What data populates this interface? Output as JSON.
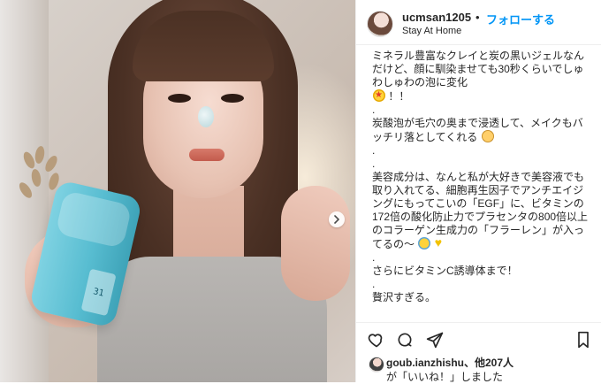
{
  "header": {
    "username": "ucmsan1205",
    "separator": "•",
    "follow_label": "フォローする",
    "location": "Stay At Home"
  },
  "post": {
    "caption_paragraphs": [
      "ミネラル豊富なクレイと炭の黒いジェルなんだけど、顔に馴染ませても30秒くらいでしゅわしゅわの泡に変化",
      "！！",
      ".",
      "炭酸泡が毛穴の奥まで浸透して、メイクもバッチリ落としてくれる",
      ".",
      ".",
      "美容成分は、なんと私が大好きで美容液でも取り入れてる、細胞再生因子でアンチエイジングにもってこいの「EGF」に、ビタミンの172倍の酸化防止力でプラセンタの800倍以上のコラーゲン生成力の「フラーレン」が入ってるの〜",
      ".",
      "さらにビタミンC誘導体まで！",
      ".",
      "贅沢すぎる。"
    ],
    "product_label": "31"
  },
  "likes": {
    "line1_user": "goub.ianzhishu",
    "line1_rest": "、他207人",
    "line2": "が「いいね！」しました"
  },
  "icons": {
    "carousel_next": "chevron-right-icon",
    "like": "heart-outline-icon",
    "comment": "comment-bubble-icon",
    "share": "paper-plane-icon",
    "save": "bookmark-outline-icon"
  },
  "colors": {
    "follow_link": "#0095f6",
    "text": "#262626",
    "divider": "#efefef"
  }
}
